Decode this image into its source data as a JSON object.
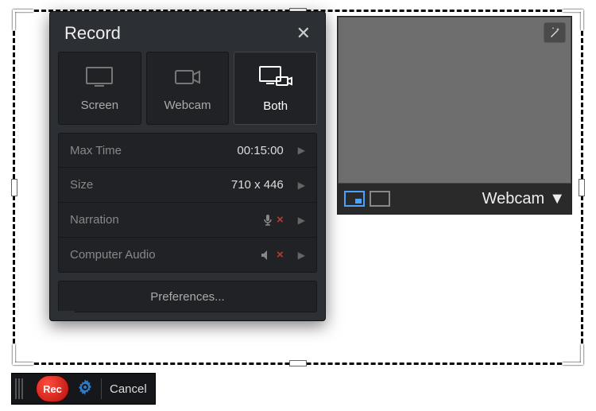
{
  "popover": {
    "title": "Record",
    "modes": {
      "screen": "Screen",
      "webcam": "Webcam",
      "both": "Both"
    },
    "settings": {
      "maxtime_label": "Max Time",
      "maxtime_value": "00:15:00",
      "size_label": "Size",
      "size_value": "710 x 446",
      "narration_label": "Narration",
      "audio_label": "Computer Audio"
    },
    "preferences": "Preferences..."
  },
  "webcam": {
    "label": "Webcam"
  },
  "controls": {
    "rec": "Rec",
    "cancel": "Cancel"
  }
}
